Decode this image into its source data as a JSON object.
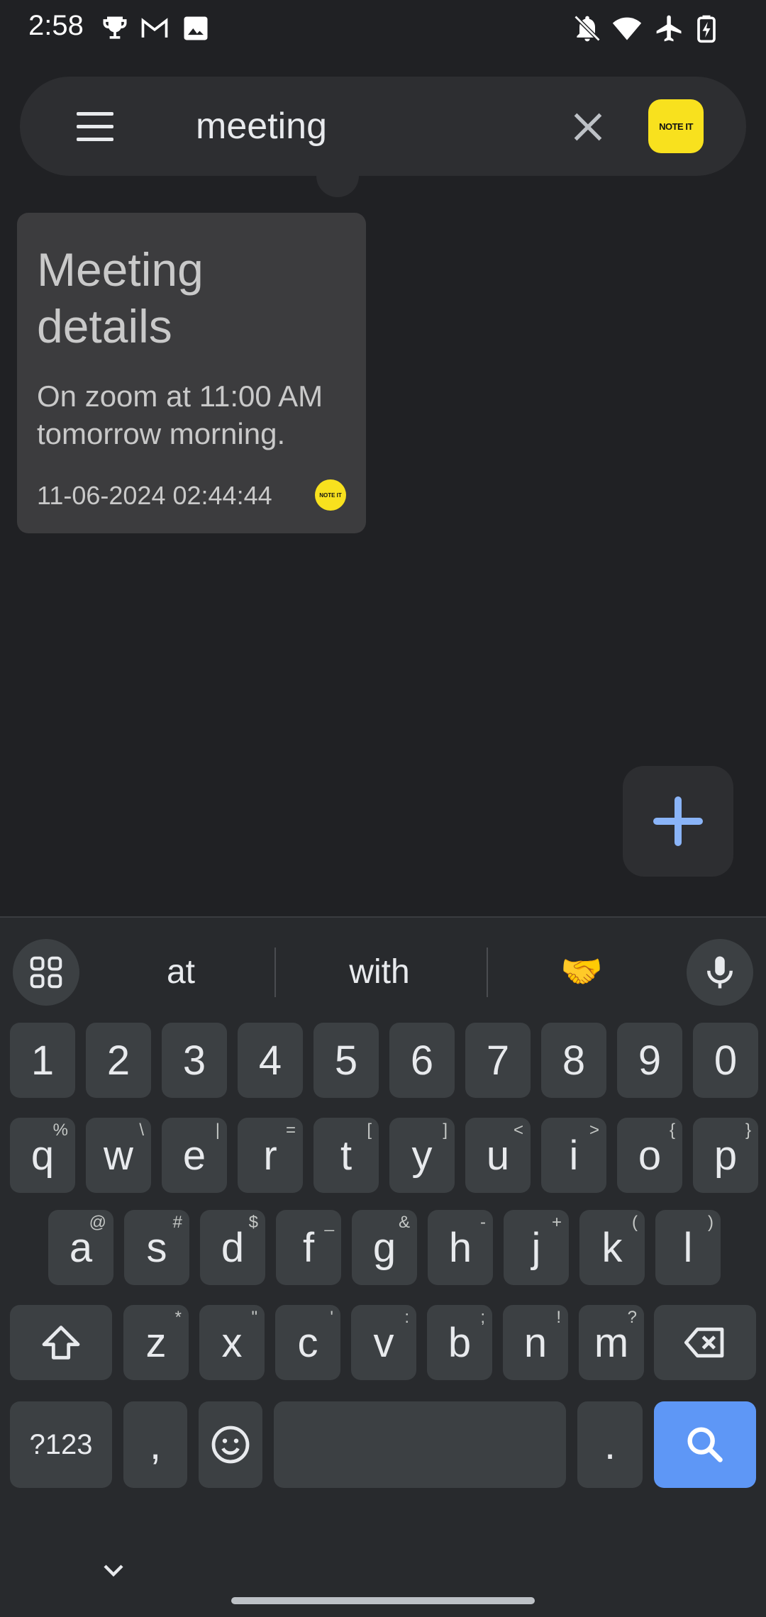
{
  "status_bar": {
    "time": "2:58",
    "left_icons": [
      "trophy-icon",
      "gmail-icon",
      "image-icon"
    ],
    "right_icons": [
      "notifications-off-icon",
      "wifi-icon",
      "airplane-mode-icon",
      "battery-charging-icon"
    ]
  },
  "search": {
    "value": "meeting",
    "menu_icon": "hamburger-menu-icon",
    "clear_icon": "close-icon",
    "app_logo_text": "NOTE IT"
  },
  "notes": [
    {
      "title": "Meeting details",
      "body": "On zoom at 11:00 AM tomorrow morning.",
      "date": "11-06-2024 02:44:44",
      "badge_text": "NOTE IT"
    }
  ],
  "fab": {
    "icon": "plus-icon",
    "color": "#8ab4f8"
  },
  "keyboard": {
    "suggestions": [
      "at",
      "with",
      "🤝"
    ],
    "row_numbers": [
      "1",
      "2",
      "3",
      "4",
      "5",
      "6",
      "7",
      "8",
      "9",
      "0"
    ],
    "row1": [
      {
        "k": "q",
        "h": "%"
      },
      {
        "k": "w",
        "h": "\\"
      },
      {
        "k": "e",
        "h": "|"
      },
      {
        "k": "r",
        "h": "="
      },
      {
        "k": "t",
        "h": "["
      },
      {
        "k": "y",
        "h": "]"
      },
      {
        "k": "u",
        "h": "<"
      },
      {
        "k": "i",
        "h": ">"
      },
      {
        "k": "o",
        "h": "{"
      },
      {
        "k": "p",
        "h": "}"
      }
    ],
    "row2": [
      {
        "k": "a",
        "h": "@"
      },
      {
        "k": "s",
        "h": "#"
      },
      {
        "k": "d",
        "h": "$"
      },
      {
        "k": "f",
        "h": "_"
      },
      {
        "k": "g",
        "h": "&"
      },
      {
        "k": "h",
        "h": "-"
      },
      {
        "k": "j",
        "h": "+"
      },
      {
        "k": "k",
        "h": "("
      },
      {
        "k": "l",
        "h": ")"
      }
    ],
    "row3": [
      {
        "k": "z",
        "h": "*"
      },
      {
        "k": "x",
        "h": "\""
      },
      {
        "k": "c",
        "h": "'"
      },
      {
        "k": "v",
        "h": ":"
      },
      {
        "k": "b",
        "h": ";"
      },
      {
        "k": "n",
        "h": "!"
      },
      {
        "k": "m",
        "h": "?"
      }
    ],
    "symbols_label": "?123",
    "comma": ",",
    "period": ".",
    "search_key_color": "#5e97f6"
  }
}
